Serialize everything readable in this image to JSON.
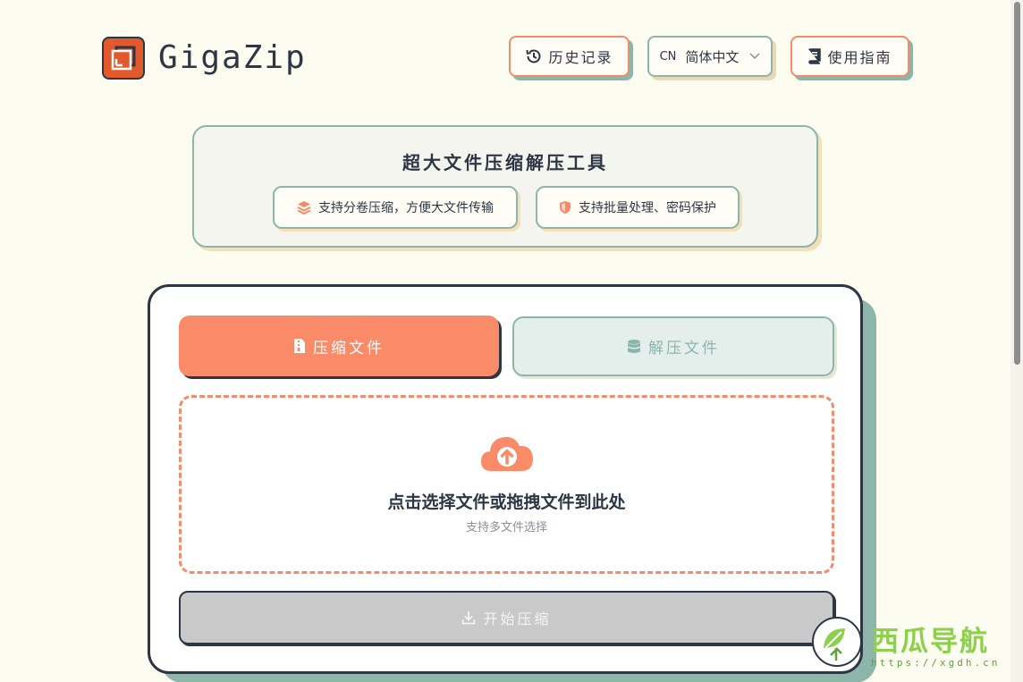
{
  "app": {
    "name": "GigaZip"
  },
  "header": {
    "history_label": "历史记录",
    "lang_code": "CN",
    "lang_label": "简体中文",
    "guide_label": "使用指南"
  },
  "info": {
    "title": "超大文件压缩解压工具",
    "features": [
      {
        "icon": "layers-icon",
        "label": "支持分卷压缩，方便大文件传输"
      },
      {
        "icon": "shield-icon",
        "label": "支持批量处理、密码保护"
      }
    ]
  },
  "tabs": [
    {
      "label": "压缩文件",
      "icon": "zip-file-icon",
      "active": true
    },
    {
      "label": "解压文件",
      "icon": "database-icon",
      "active": false
    }
  ],
  "dropzone": {
    "title": "点击选择文件或拖拽文件到此处",
    "subtitle": "支持多文件选择"
  },
  "start_button": {
    "label": "开始压缩",
    "disabled": true
  },
  "watermark": {
    "name": "西瓜导航",
    "url": "https://xgdh.cn"
  },
  "colors": {
    "background": "#fdfcf1",
    "accent": "#f98b69",
    "teal": "#8db5a9",
    "dark": "#2c3644",
    "logo": "#e25a2b"
  }
}
